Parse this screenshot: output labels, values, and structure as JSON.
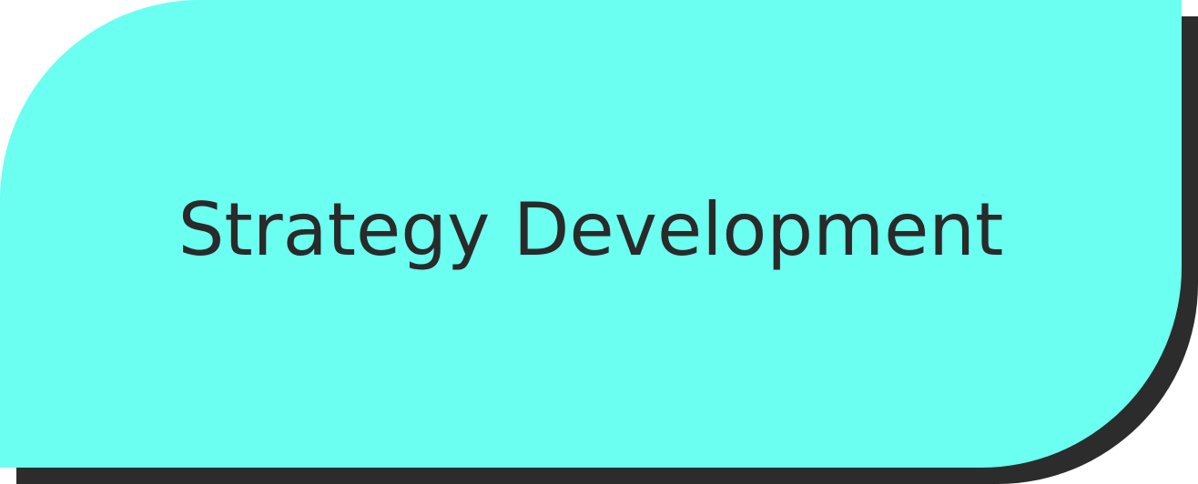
{
  "card": {
    "label": "Strategy Development",
    "background_color": "#6afff0",
    "shadow_color": "#2c2c2c",
    "text_color": "#2a2a2a"
  }
}
